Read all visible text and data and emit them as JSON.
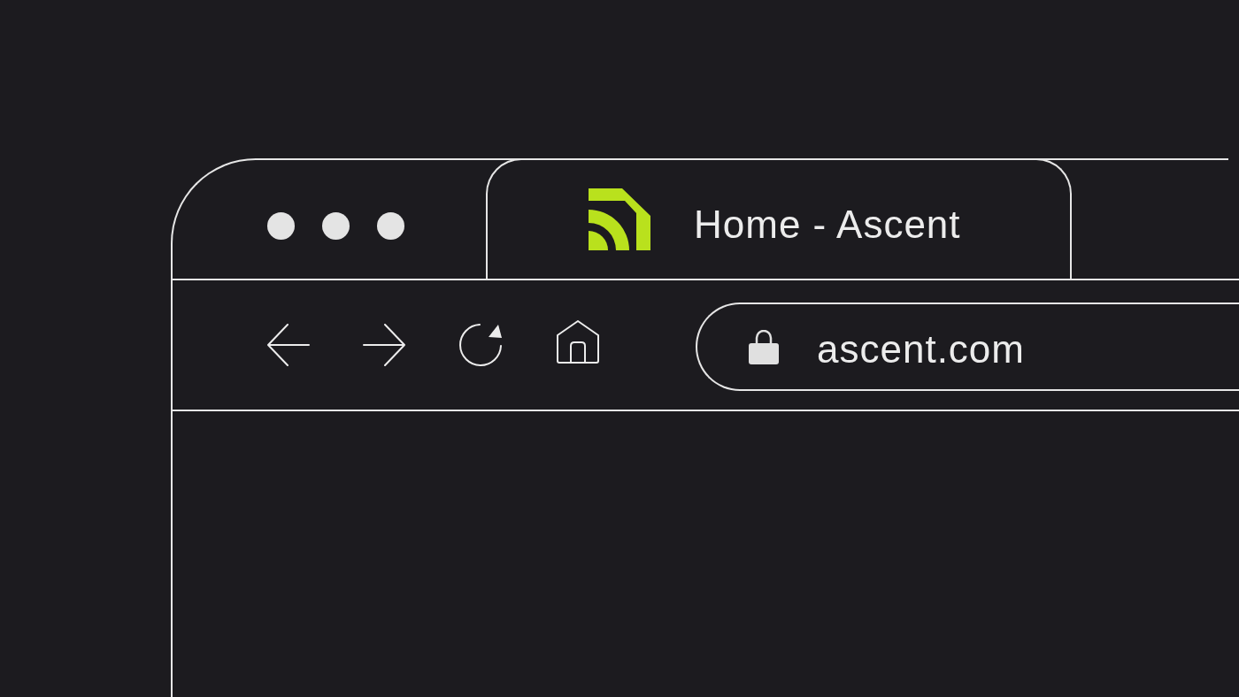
{
  "window": {
    "tabs": [
      {
        "title": "Home - Ascent",
        "selected": true
      }
    ],
    "address_bar": {
      "value": "ascent.com",
      "secure": true
    }
  }
}
